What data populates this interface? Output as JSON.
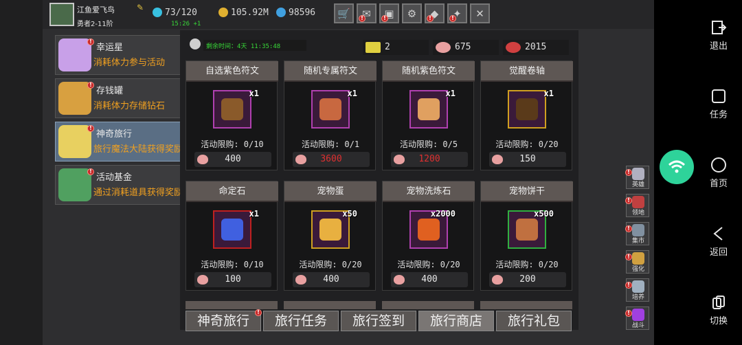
{
  "player": {
    "name": "江鱼爱飞鸟",
    "rank": "勇者2-11阶"
  },
  "resources": {
    "stamina": "73/120",
    "stamina_timer": "15:26 +1",
    "gold": "105.92M",
    "gems": "98596"
  },
  "top_icons": [
    {
      "name": "shop-cart-icon",
      "symbol": "🛒",
      "badge": false
    },
    {
      "name": "mail-icon",
      "symbol": "✉",
      "badge": true
    },
    {
      "name": "chest-icon",
      "symbol": "▣",
      "badge": true
    },
    {
      "name": "settings-icon",
      "symbol": "⚙",
      "badge": false
    },
    {
      "name": "event-icon",
      "symbol": "◆",
      "badge": true
    },
    {
      "name": "rank-icon",
      "symbol": "✦",
      "badge": true
    },
    {
      "name": "close-icon",
      "symbol": "✕",
      "badge": false
    }
  ],
  "sidebar": {
    "items": [
      {
        "title": "幸运星",
        "desc": "消耗体力参与活动",
        "color": "#c8a0e8"
      },
      {
        "title": "存钱罐",
        "desc": "消耗体力存储钻石",
        "color": "#d8a040"
      },
      {
        "title": "神奇旅行",
        "desc": "旅行魔法大陆获得奖励",
        "color": "#e8d060"
      },
      {
        "title": "活动基金",
        "desc": "通过消耗道具获得奖励",
        "color": "#50a060"
      }
    ]
  },
  "info": {
    "remaining_label": "剩余时间：4天 11:35:48",
    "currency": [
      {
        "name": "ticket",
        "value": "2",
        "color": "#e0d040"
      },
      {
        "name": "pouch-pink",
        "value": "675",
        "color": "#e8a0a0"
      },
      {
        "name": "pouch-red",
        "value": "2015",
        "color": "#d04040"
      }
    ]
  },
  "shop_items": [
    {
      "title": "自选紫色符文",
      "qty": "x1",
      "limit": "活动限购: 0/10",
      "price": "400",
      "price_red": false,
      "border": "#b040b0",
      "fill": "#8a5a2a"
    },
    {
      "title": "随机专属符文",
      "qty": "x1",
      "limit": "活动限购: 0/1",
      "price": "3600",
      "price_red": true,
      "border": "#b040b0",
      "fill": "#c86840"
    },
    {
      "title": "随机紫色符文",
      "qty": "x1",
      "limit": "活动限购: 0/5",
      "price": "1200",
      "price_red": true,
      "border": "#b040b0",
      "fill": "#e0a060"
    },
    {
      "title": "觉醒卷轴",
      "qty": "x1",
      "limit": "活动限购: 0/20",
      "price": "150",
      "price_red": false,
      "border": "#d0a020",
      "fill": "#5a3a1a"
    },
    {
      "title": "命定石",
      "qty": "x1",
      "limit": "活动限购: 0/10",
      "price": "100",
      "price_red": false,
      "border": "#c02020",
      "fill": "#4060e0"
    },
    {
      "title": "宠物蛋",
      "qty": "x50",
      "limit": "活动限购: 0/20",
      "price": "400",
      "price_red": false,
      "border": "#d0a020",
      "fill": "#e8b040"
    },
    {
      "title": "宠物洗炼石",
      "qty": "x2000",
      "limit": "活动限购: 0/20",
      "price": "400",
      "price_red": false,
      "border": "#b040b0",
      "fill": "#e06020"
    },
    {
      "title": "宠物饼干",
      "qty": "x500",
      "limit": "活动限购: 0/20",
      "price": "200",
      "price_red": false,
      "border": "#30b040",
      "fill": "#c07040"
    }
  ],
  "tabs": [
    {
      "label": "神奇旅行",
      "badge": true
    },
    {
      "label": "旅行任务",
      "badge": false
    },
    {
      "label": "旅行签到",
      "badge": false
    },
    {
      "label": "旅行商店",
      "badge": false,
      "active": true
    },
    {
      "label": "旅行礼包",
      "badge": false
    }
  ],
  "right_menu": [
    {
      "label": "英雄",
      "color": "#b0b0c0"
    },
    {
      "label": "领地",
      "color": "#c04040"
    },
    {
      "label": "集市",
      "color": "#8090a0"
    },
    {
      "label": "强化",
      "color": "#d0a040"
    },
    {
      "label": "培养",
      "color": "#a0b0c0"
    },
    {
      "label": "战斗",
      "color": "#a040e0"
    }
  ],
  "system_bar": [
    {
      "label": "退出",
      "icon": "exit-icon"
    },
    {
      "label": "任务",
      "icon": "task-icon"
    },
    {
      "label": "首页",
      "icon": "home-icon"
    },
    {
      "label": "返回",
      "icon": "back-icon"
    },
    {
      "label": "切换",
      "icon": "switch-icon"
    }
  ]
}
